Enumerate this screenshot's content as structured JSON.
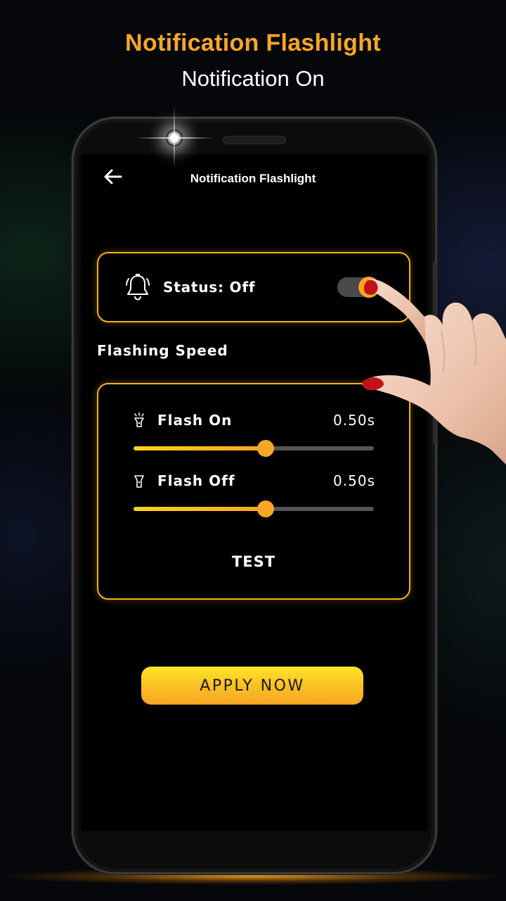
{
  "promo": {
    "title": "Notification Flashlight",
    "subtitle": "Notification On"
  },
  "app_bar": {
    "back_icon": "arrow-left-icon",
    "title": "Notification Flashlight"
  },
  "status_card": {
    "icon": "bell-icon",
    "label": "Status: Off",
    "toggle_on": true
  },
  "section": {
    "label": "Flashing Speed"
  },
  "flash_on": {
    "icon": "flashlight-on-icon",
    "label": "Flash On",
    "value": "0.50s",
    "slider_fraction": 0.55
  },
  "flash_off": {
    "icon": "flashlight-off-icon",
    "label": "Flash Off",
    "value": "0.50s",
    "slider_fraction": 0.55
  },
  "test_button": {
    "label": "TEST"
  },
  "apply_button": {
    "label": "APPLY NOW"
  },
  "colors": {
    "accent": "#f7a626",
    "accent_light": "#fde528",
    "card_border": "#f2b21e",
    "background": "#000000"
  }
}
